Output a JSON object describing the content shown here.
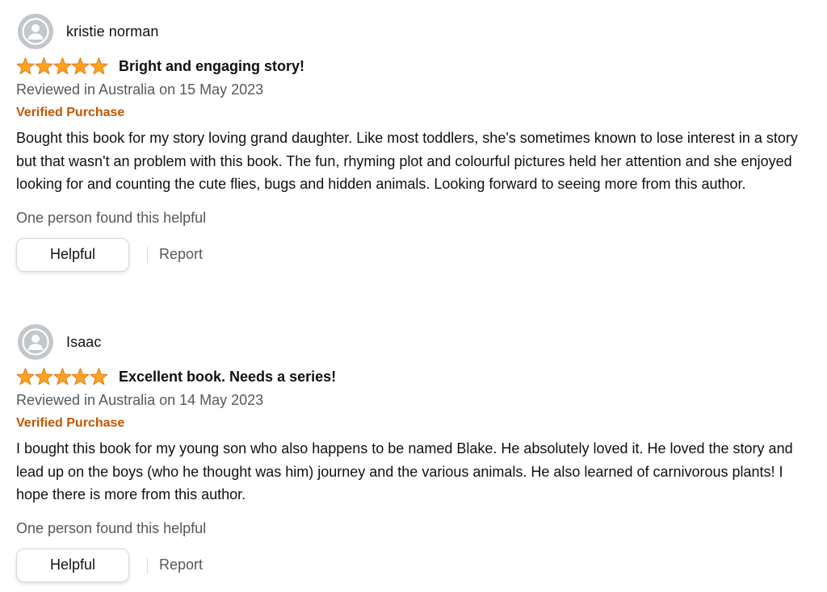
{
  "colors": {
    "star": "#ffa41c",
    "verified": "#c45500",
    "muted": "#565959",
    "text": "#0f1111"
  },
  "reviews": [
    {
      "author": "kristie norman",
      "avatar_icon": "default-user-avatar-icon",
      "rating": 5,
      "rating_max": 5,
      "title": "Bright and engaging story!",
      "date_line": "Reviewed in Australia on 15 May 2023",
      "verified": "Verified Purchase",
      "body": "Bought this book for my story loving grand daughter. Like most toddlers, she's sometimes known to lose interest in a story but that wasn't an problem with this book. The fun, rhyming plot and colourful pictures held her attention and she enjoyed looking for and counting the cute flies, bugs and hidden animals. Looking forward to seeing more from this author.",
      "helpful_count": "One person found this helpful",
      "helpful_label": "Helpful",
      "report_label": "Report"
    },
    {
      "author": "Isaac",
      "avatar_icon": "default-user-avatar-icon",
      "rating": 5,
      "rating_max": 5,
      "title": "Excellent book. Needs a series!",
      "date_line": "Reviewed in Australia on 14 May 2023",
      "verified": "Verified Purchase",
      "body": "I bought this book for my young son who also happens to be named Blake. He absolutely loved it. He loved the story and lead up on the boys (who he thought was him) journey and the various animals. He also learned of carnivorous plants! I hope there is more from this author.",
      "helpful_count": "One person found this helpful",
      "helpful_label": "Helpful",
      "report_label": "Report"
    }
  ]
}
